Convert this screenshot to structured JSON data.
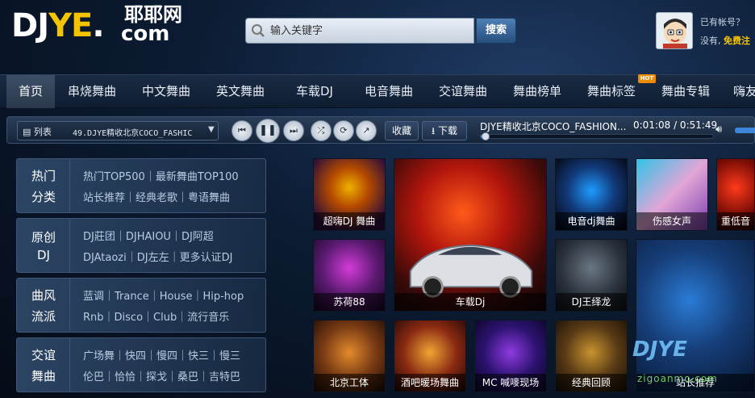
{
  "logo": {
    "en_prefix": "DJ",
    "en_mid": "YE",
    "en_suffix": ".",
    "cn": "耶耶网",
    "com": "com"
  },
  "search": {
    "placeholder": "输入关键字",
    "button": "搜索"
  },
  "user": {
    "prompt": "已有帐号？",
    "line_prefix": "没有,",
    "free_register": "免费注"
  },
  "nav": {
    "items": [
      "首页",
      "串烧舞曲",
      "中文舞曲",
      "英文舞曲",
      "车载DJ",
      "电音舞曲",
      "交谊舞曲",
      "舞曲榜单",
      "舞曲标签",
      "舞曲专辑",
      "嗨友"
    ],
    "active_index": 0,
    "hot_badge": "HOT"
  },
  "player": {
    "list_label": "列表",
    "current_track_short": "49.DJYE精收北京COCO_FASHIC",
    "fav_button": "收藏",
    "download_button": "下载",
    "now_playing": "DJYE精收北京COCO_FASHION...",
    "time": "0:01:08 / 0:51:49",
    "progress_fraction": 0.022,
    "accent_color": "#5b8ed0"
  },
  "categories": [
    {
      "title_line1": "热门",
      "title_line2": "分类",
      "line1": "热门TOP500｜最新舞曲TOP100",
      "line2": "站长推荐｜经典老歌｜粤语舞曲"
    },
    {
      "title_line1": "原创",
      "title_line2": "DJ",
      "line1": "DJ莊团｜DJHAIOU｜DJ阿超",
      "line2": "DJAtaozi｜DJ左左｜更多认证DJ"
    },
    {
      "title_line1": "曲风",
      "title_line2": "流派",
      "line1": "蓝调｜Trance｜House｜Hip-hop",
      "line2": "Rnb｜Disco｜Club｜流行音乐"
    },
    {
      "title_line1": "交谊",
      "title_line2": "舞曲",
      "line1": "广场舞｜快四｜慢四｜快三｜慢三",
      "line2": "伦巴｜恰恰｜探戈｜桑巴｜吉特巴"
    }
  ],
  "tiles": [
    "超嗨DJ 舞曲",
    "车载Dj",
    "电音dj舞曲",
    "伤感女声",
    "重低音",
    "苏荷88",
    "DJ王绎龙",
    "站长推荐",
    "北京工体",
    "酒吧暖场舞曲",
    "MC 喊嘜现场",
    "经典回顾"
  ],
  "watermark": {
    "brand": "DJYE",
    "url": "zigoanmo.com"
  }
}
